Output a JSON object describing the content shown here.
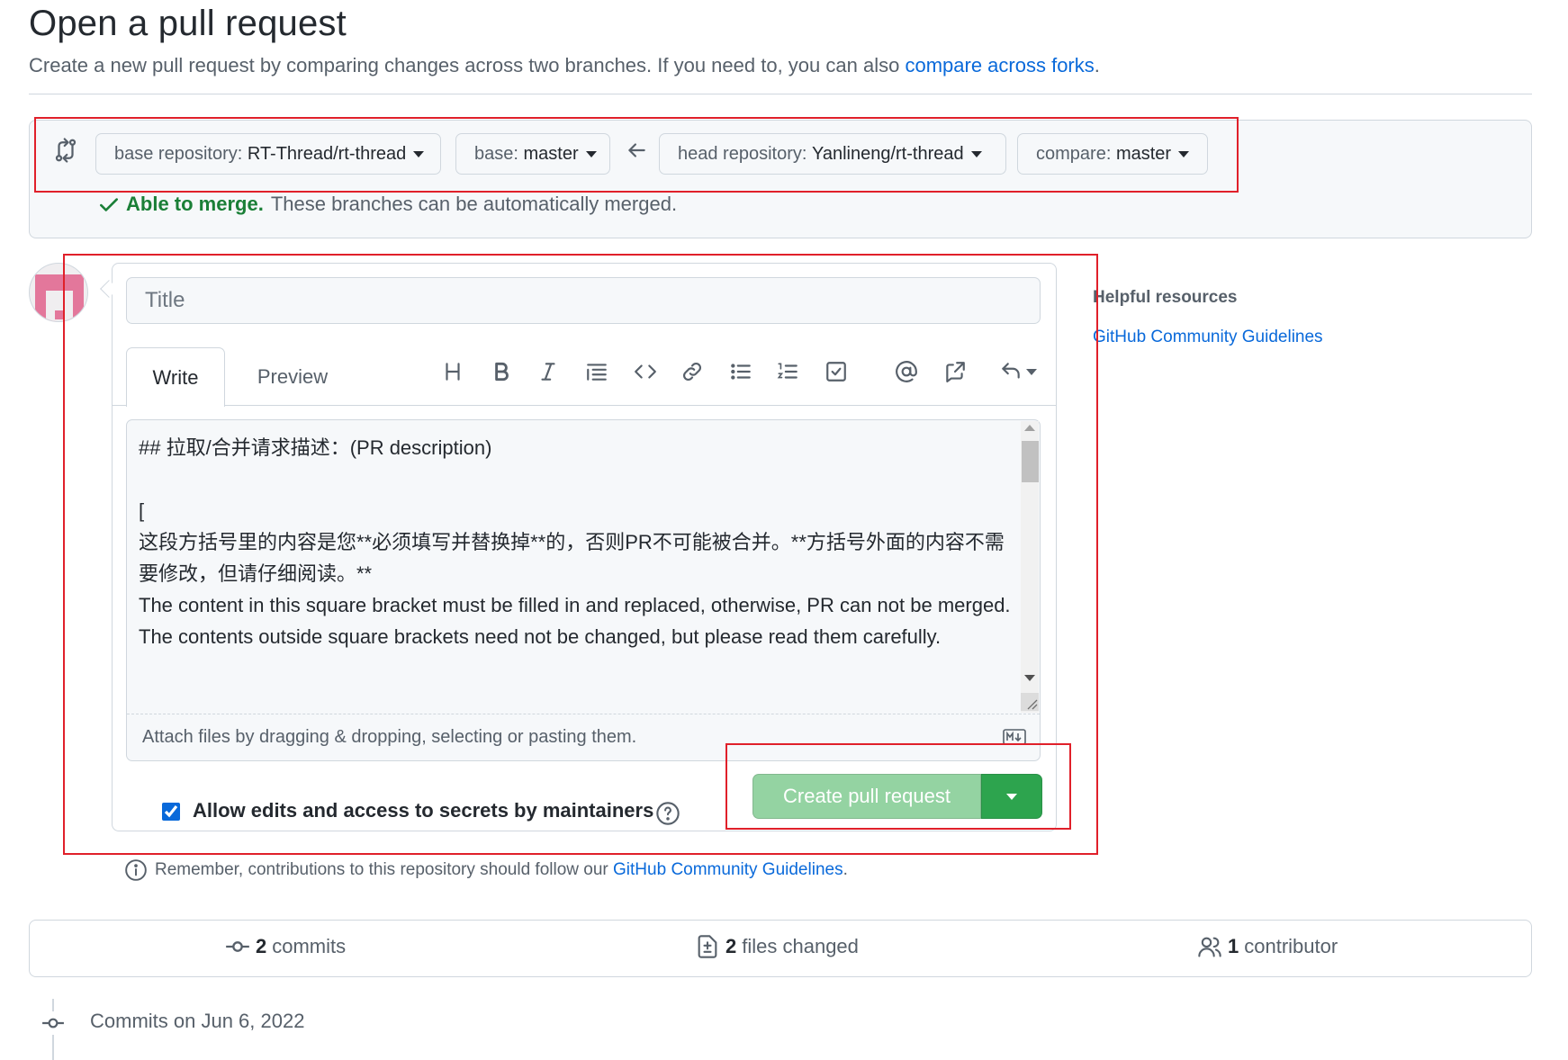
{
  "header": {
    "title": "Open a pull request",
    "subtitle": "Create a new pull request by comparing changes across two branches. If you need to, you can also",
    "subtitle_link": "compare across forks",
    "subtitle_end": "."
  },
  "compare": {
    "base_repo_label": "base repository: ",
    "base_repo_value": "RT-Thread/rt-thread",
    "base_label": "base: ",
    "base_value": "master",
    "head_repo_label": "head repository: ",
    "head_repo_value": "Yanlineng/rt-thread",
    "compare_label": "compare: ",
    "compare_value": "master",
    "merge_status": "Able to merge.",
    "merge_message": "These branches can be automatically merged."
  },
  "editor": {
    "title_placeholder": "Title",
    "tab_write": "Write",
    "tab_preview": "Preview",
    "body": "## 拉取/合并请求描述：(PR description)\n\n[\n这段方括号里的内容是您**必须填写并替换掉**的，否则PR不可能被合并。**方括号外面的内容不需要修改，但请仔细阅读。**\nThe content in this square bracket must be filled in and replaced, otherwise, PR can not be merged. The contents outside square brackets need not be changed, but please read them carefully.",
    "attach_text": "Attach files by dragging & dropping, selecting or pasting them.",
    "toolbar": [
      "heading-icon",
      "bold-icon",
      "italic-icon",
      "quote-icon",
      "code-icon",
      "link-icon",
      "unordered-list-icon",
      "ordered-list-icon",
      "task-list-icon",
      "mention-icon",
      "cross-reference-icon",
      "reply-icon"
    ]
  },
  "allow_edits": {
    "label": "Allow edits and access to secrets by maintainers",
    "checked": true
  },
  "create_button": {
    "label": "Create pull request"
  },
  "remember": {
    "text": "Remember, contributions to this repository should follow our",
    "link": "GitHub Community Guidelines",
    "end": "."
  },
  "sidebar": {
    "title": "Helpful resources",
    "link": "GitHub Community Guidelines"
  },
  "stats": {
    "commits_count": "2",
    "commits_label": "commits",
    "files_count": "2",
    "files_label": "files changed",
    "contributors_count": "1",
    "contributors_label": "contributor"
  },
  "timeline": {
    "label": "Commits on Jun 6, 2022"
  },
  "colors": {
    "link": "#0969da",
    "success": "#1a7f37",
    "button_disabled": "#94d3a2",
    "button_green": "#2da44e",
    "annotation_red": "#e0202a"
  }
}
